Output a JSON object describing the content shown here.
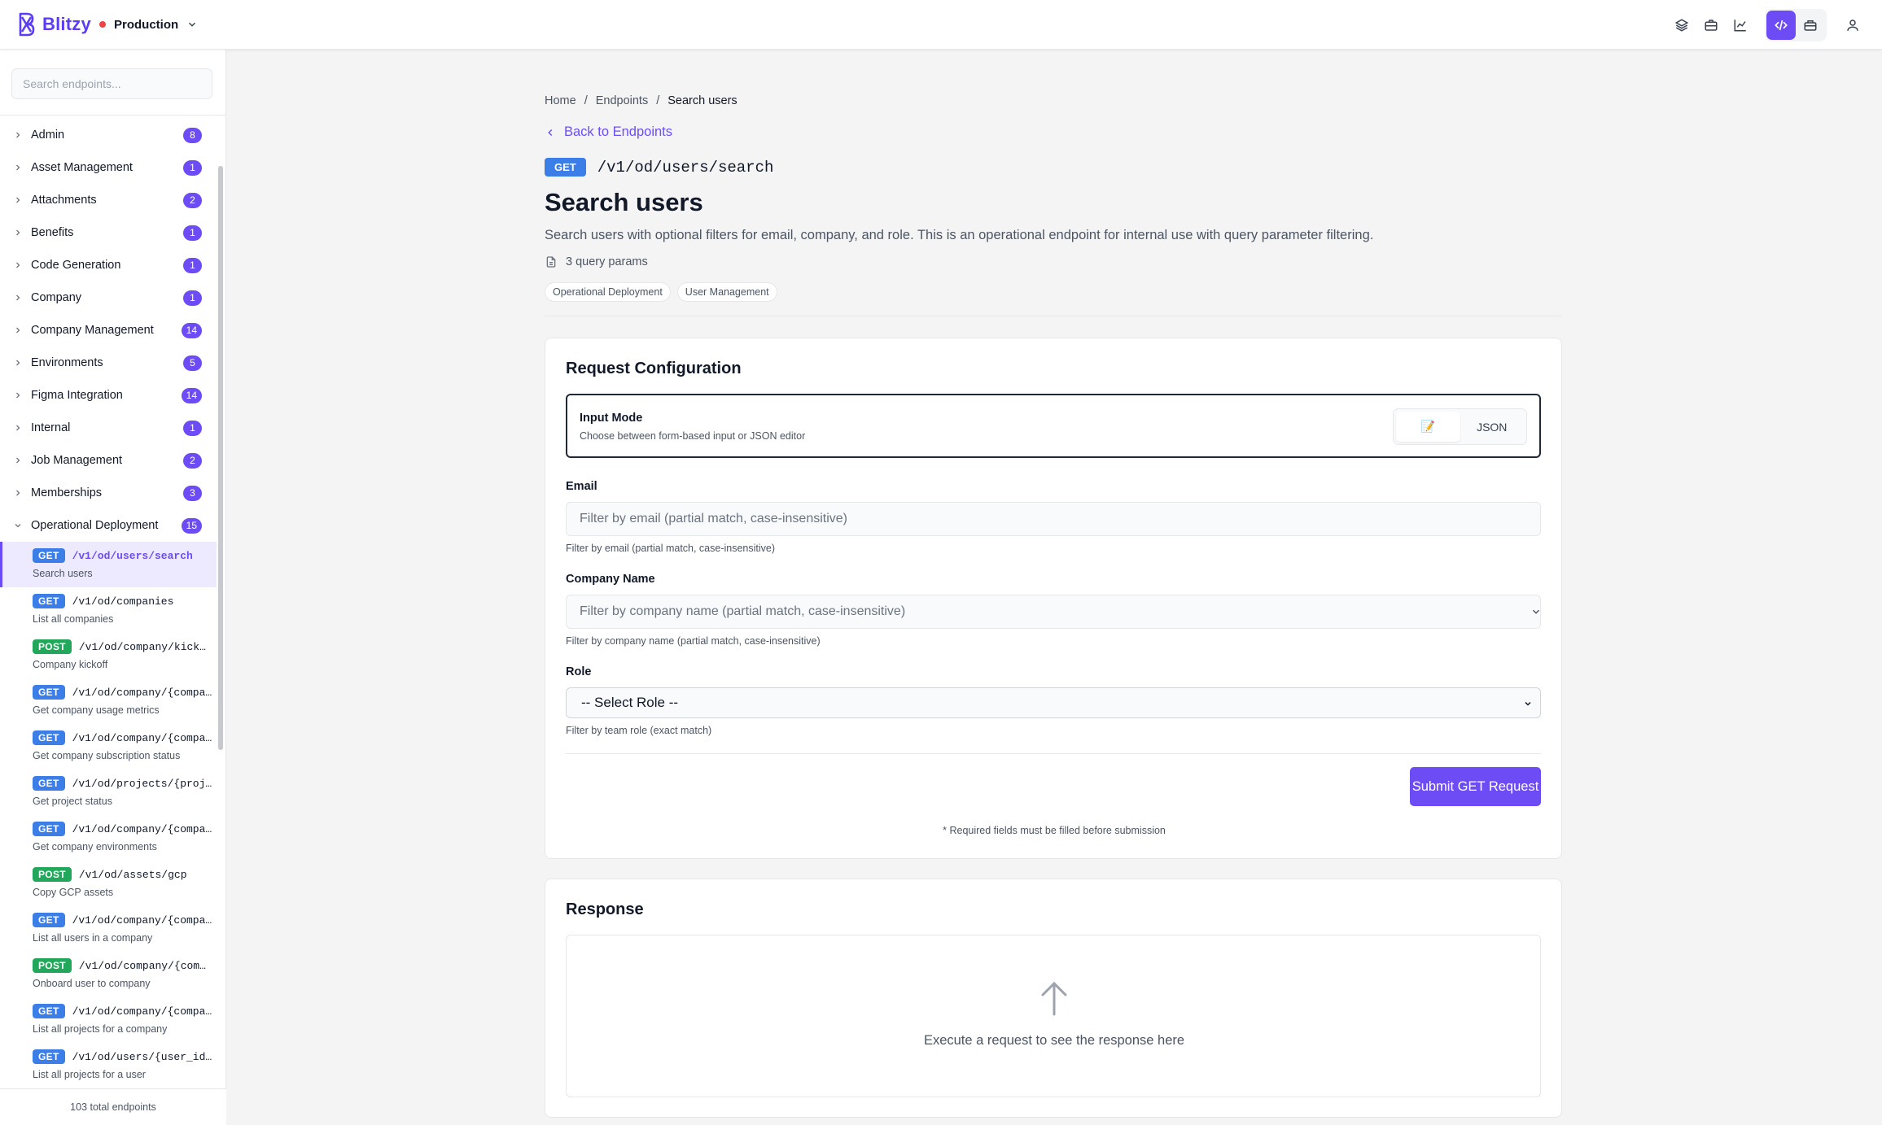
{
  "app": {
    "name": "Blitzy",
    "environment": "Production"
  },
  "sidebar": {
    "search_placeholder": "Search endpoints...",
    "categories": [
      {
        "label": "Admin",
        "count": "8",
        "expanded": false
      },
      {
        "label": "Asset Management",
        "count": "1",
        "expanded": false
      },
      {
        "label": "Attachments",
        "count": "2",
        "expanded": false
      },
      {
        "label": "Benefits",
        "count": "1",
        "expanded": false
      },
      {
        "label": "Code Generation",
        "count": "1",
        "expanded": false
      },
      {
        "label": "Company",
        "count": "1",
        "expanded": false
      },
      {
        "label": "Company Management",
        "count": "14",
        "expanded": false
      },
      {
        "label": "Environments",
        "count": "5",
        "expanded": false
      },
      {
        "label": "Figma Integration",
        "count": "14",
        "expanded": false
      },
      {
        "label": "Internal",
        "count": "1",
        "expanded": false
      },
      {
        "label": "Job Management",
        "count": "2",
        "expanded": false
      },
      {
        "label": "Memberships",
        "count": "3",
        "expanded": false
      },
      {
        "label": "Operational Deployment",
        "count": "15",
        "expanded": true
      }
    ],
    "endpoints": [
      {
        "method": "GET",
        "path": "/v1/od/users/search",
        "desc": "Search users",
        "active": true
      },
      {
        "method": "GET",
        "path": "/v1/od/companies",
        "desc": "List all companies"
      },
      {
        "method": "POST",
        "path": "/v1/od/company/kick…",
        "desc": "Company kickoff"
      },
      {
        "method": "GET",
        "path": "/v1/od/company/{compa…",
        "desc": "Get company usage metrics"
      },
      {
        "method": "GET",
        "path": "/v1/od/company/{compa…",
        "desc": "Get company subscription status"
      },
      {
        "method": "GET",
        "path": "/v1/od/projects/{proj…",
        "desc": "Get project status"
      },
      {
        "method": "GET",
        "path": "/v1/od/company/{compa…",
        "desc": "Get company environments"
      },
      {
        "method": "POST",
        "path": "/v1/od/assets/gcp",
        "desc": "Copy GCP assets"
      },
      {
        "method": "GET",
        "path": "/v1/od/company/{compa…",
        "desc": "List all users in a company"
      },
      {
        "method": "POST",
        "path": "/v1/od/company/{com…",
        "desc": "Onboard user to company"
      },
      {
        "method": "GET",
        "path": "/v1/od/company/{compa…",
        "desc": "List all projects for a company"
      },
      {
        "method": "GET",
        "path": "/v1/od/users/{user_id…",
        "desc": "List all projects for a user"
      }
    ],
    "footer": "103 total endpoints"
  },
  "main": {
    "breadcrumb": {
      "home": "Home",
      "sep": "/",
      "endpoints": "Endpoints",
      "current": "Search users"
    },
    "back_label": "Back to Endpoints",
    "method": "GET",
    "path": "/v1/od/users/search",
    "title": "Search users",
    "description": "Search users with optional filters for email, company, and role. This is an operational endpoint for internal use with query parameter filtering.",
    "params_label": "3 query params",
    "tags": [
      "Operational Deployment",
      "User Management"
    ]
  },
  "request": {
    "title": "Request Configuration",
    "input_mode_title": "Input Mode",
    "input_mode_sub": "Choose between form-based input or JSON editor",
    "mode_form_icon": "📝",
    "mode_json": "JSON",
    "email_label": "Email",
    "email_placeholder": "Filter by email (partial match, case-insensitive)",
    "email_help": "Filter by email (partial match, case-insensitive)",
    "company_label": "Company Name",
    "company_placeholder": "Filter by company name (partial match, case-insensitive)",
    "company_help": "Filter by company name (partial match, case-insensitive)",
    "role_label": "Role",
    "role_selected": "-- Select Role --",
    "role_help": "Filter by team role (exact match)",
    "submit_label": "Submit GET Request",
    "required_note": "* Required fields must be filled before submission"
  },
  "response": {
    "title": "Response",
    "empty_text": "Execute a request to see the response here"
  },
  "colors": {
    "accent": "#6d4cf6",
    "get": "#3b7ee8",
    "post": "#22a85a",
    "env_dot": "#ef4444"
  }
}
